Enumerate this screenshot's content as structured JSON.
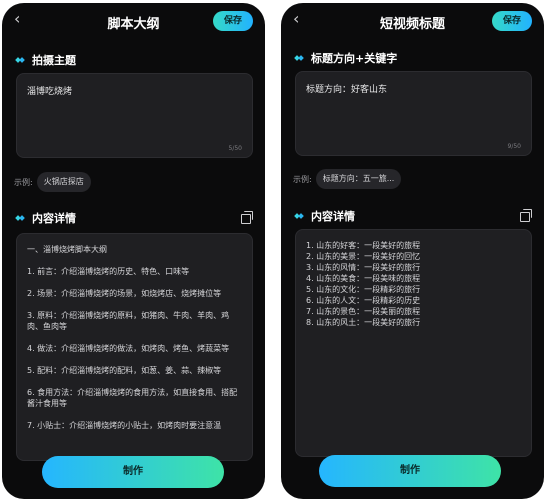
{
  "left": {
    "back_icon": "‹",
    "title": "脚本大纲",
    "save_label": "保存",
    "topic_label": "拍摄主题",
    "topic_value": "淄博吃烧烤",
    "counter": "5/50",
    "example_prefix": "示例:",
    "example_chip": "火锅店探店",
    "detail_label": "内容详情",
    "detail_lines": [
      "一、淄博烧烤脚本大纲",
      "1. 前言：介绍淄博烧烤的历史、特色、口味等",
      "2. 场景：介绍淄博烧烤的场景，如烧烤店、烧烤摊位等",
      "3. 原料：介绍淄博烧烤的原料，如猪肉、牛肉、羊肉、鸡肉、鱼肉等",
      "4. 做法：介绍淄博烧烤的做法，如烤肉、烤鱼、烤蔬菜等",
      "5. 配料：介绍淄博烧烤的配料，如葱、姜、蒜、辣椒等",
      "6. 食用方法：介绍淄博烧烤的食用方法，如直接食用、搭配酱汁食用等",
      "7. 小贴士：介绍淄博烧烤的小贴士，如烤肉时要注意温"
    ],
    "make_label": "制作"
  },
  "right": {
    "back_icon": "‹",
    "title": "短视频标题",
    "save_label": "保存",
    "topic_label": "标题方向+关键字",
    "topic_value": "标题方向：好客山东",
    "counter": "9/50",
    "example_prefix": "示例:",
    "example_chip": "标题方向：五一旅...",
    "detail_label": "内容详情",
    "detail_lines": [
      "1. 山东的好客：一段美好的旅程",
      "2. 山东的美景：一段美好的回忆",
      "3. 山东的风情：一段美好的旅行",
      "4. 山东的美食：一段美味的旅程",
      "5. 山东的文化：一段精彩的旅行",
      "6. 山东的人文：一段精彩的历史",
      "7. 山东的景色：一段美丽的旅程",
      "8. 山东的风土：一段美好的旅行"
    ],
    "make_label": "制作"
  }
}
